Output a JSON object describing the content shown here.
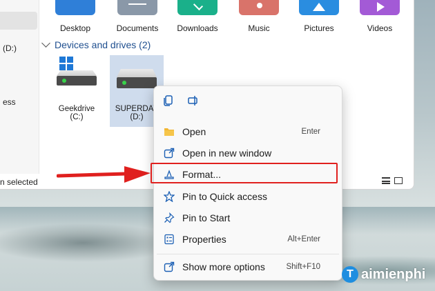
{
  "sidebar": {
    "items": [
      "",
      "(D:)",
      "ess"
    ]
  },
  "folders": [
    {
      "label": "Desktop",
      "color": "#2f7fd8"
    },
    {
      "label": "Documents",
      "color": "#8a98a8"
    },
    {
      "label": "Downloads",
      "color": "#1ab08a"
    },
    {
      "label": "Music",
      "color": "#d9736a"
    },
    {
      "label": "Pictures",
      "color": "#2a8de0"
    },
    {
      "label": "Videos",
      "color": "#a35ad6"
    }
  ],
  "devices_group": {
    "title": "Devices and drives (2)"
  },
  "drives": [
    {
      "name": "Geekdrive",
      "letter": "(C:)",
      "selected": false,
      "has_windows_logo": true
    },
    {
      "name": "SUPERDAV",
      "letter": "(D:)",
      "selected": true,
      "has_windows_logo": false
    }
  ],
  "status": {
    "text": "n selected"
  },
  "context_menu": {
    "toolbar": [
      "copy-icon",
      "rename-icon"
    ],
    "items": [
      {
        "label": "Open",
        "shortcut": "Enter",
        "icon": "folder-icon"
      },
      {
        "label": "Open in new window",
        "shortcut": "",
        "icon": "open-new-window-icon"
      },
      {
        "label": "Format...",
        "shortcut": "",
        "icon": "format-icon"
      },
      {
        "label": "Pin to Quick access",
        "shortcut": "",
        "icon": "star-pin-icon"
      },
      {
        "label": "Pin to Start",
        "shortcut": "",
        "icon": "pin-icon"
      },
      {
        "label": "Properties",
        "shortcut": "Alt+Enter",
        "icon": "properties-icon"
      },
      {
        "label": "Show more options",
        "shortcut": "Shift+F10",
        "icon": "more-options-icon"
      }
    ],
    "highlighted": "Format...",
    "highlight_color": "#e0201e"
  },
  "watermark": {
    "text": "aimienphi",
    "initial": "T"
  }
}
